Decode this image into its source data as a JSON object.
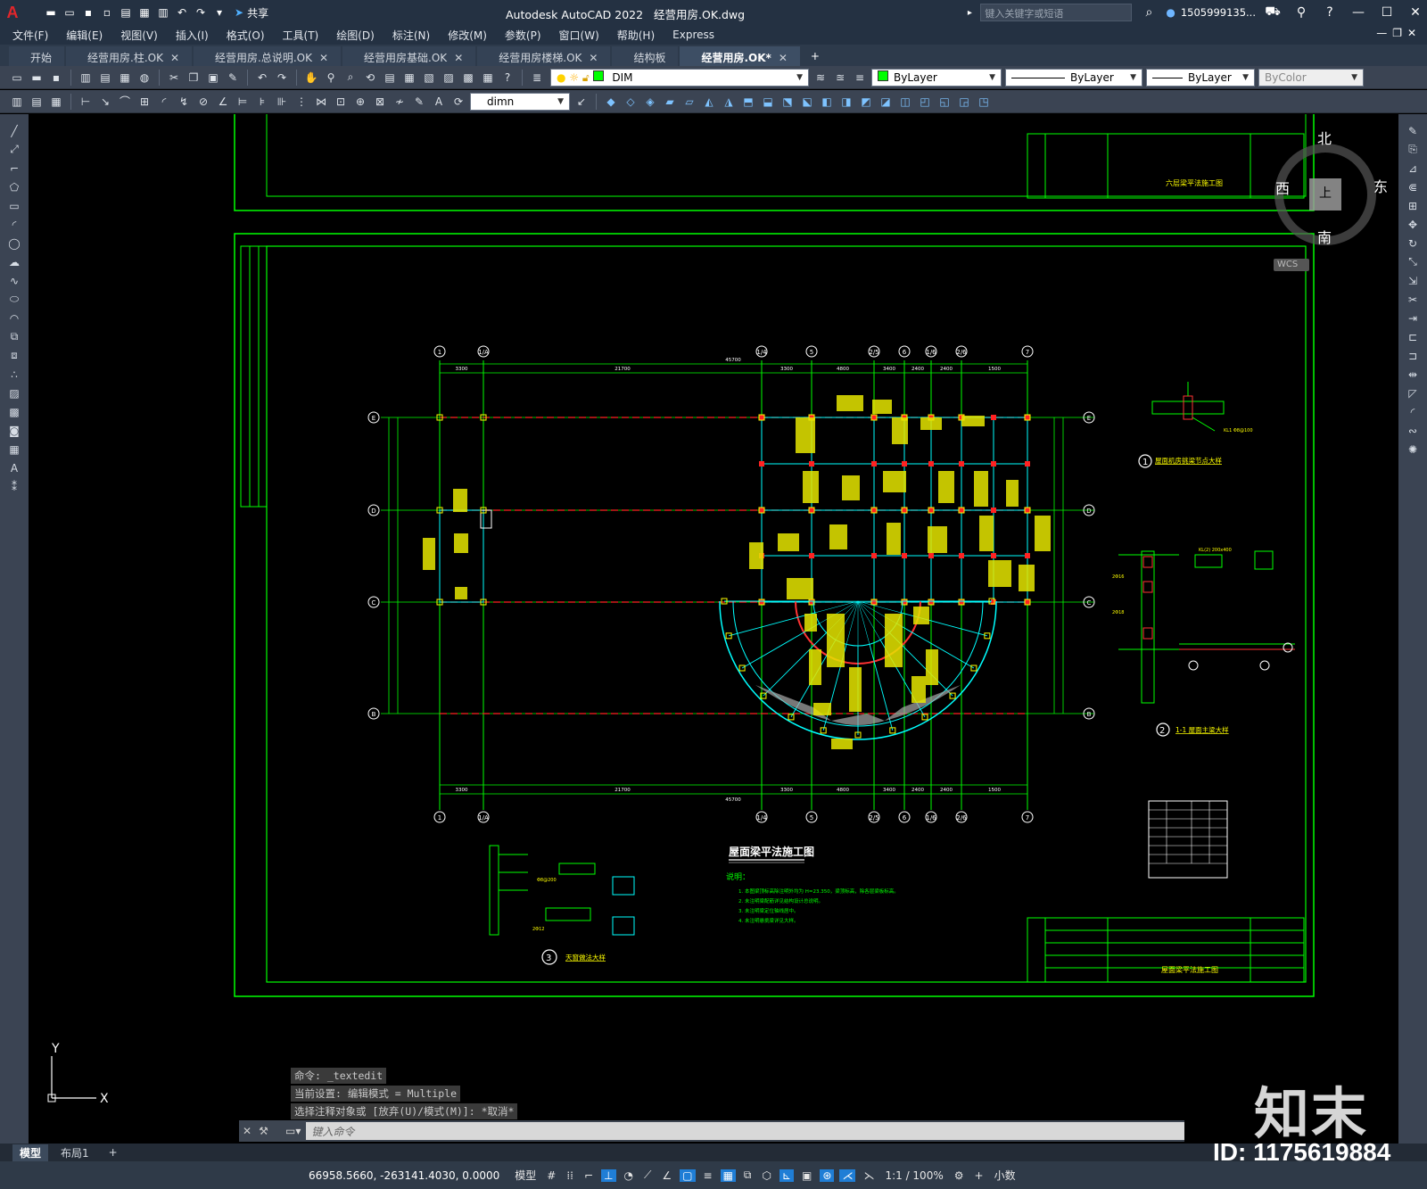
{
  "titlebar": {
    "share_label": "共享",
    "app_title": "Autodesk AutoCAD 2022",
    "file_title": "经营用房.OK.dwg",
    "search_placeholder": "键入关键字或短语",
    "user_name": "1505999135..."
  },
  "menu": [
    "文件(F)",
    "编辑(E)",
    "视图(V)",
    "插入(I)",
    "格式(O)",
    "工具(T)",
    "绘图(D)",
    "标注(N)",
    "修改(M)",
    "参数(P)",
    "窗口(W)",
    "帮助(H)",
    "Express"
  ],
  "tabs": [
    {
      "label": "开始",
      "active": false,
      "closable": false
    },
    {
      "label": "经营用房.柱.OK",
      "active": false,
      "closable": true
    },
    {
      "label": "经营用房.总说明.OK",
      "active": false,
      "closable": true
    },
    {
      "label": "经营用房基础.OK",
      "active": false,
      "closable": true
    },
    {
      "label": "经营用房楼梯.OK",
      "active": false,
      "closable": true
    },
    {
      "label": "结构板",
      "active": false,
      "closable": false
    },
    {
      "label": "经营用房.OK*",
      "active": true,
      "closable": true
    }
  ],
  "toolbar": {
    "layer_value": "DIM",
    "color_value": "ByLayer",
    "linetype_value": "ByLayer",
    "lineweight_value": "ByLayer",
    "plotstyle_value": "ByColor",
    "dimstyle_value": "dimn"
  },
  "compass": {
    "north": "北",
    "south": "南",
    "east": "东",
    "west": "西",
    "center": "上",
    "wcs": "WCS"
  },
  "drawing": {
    "grid_top": [
      "1",
      "1/A",
      "1/4",
      "5",
      "2/5",
      "6",
      "1/6",
      "2/6",
      "7"
    ],
    "grid_rows": [
      "E",
      "D",
      "C",
      "B"
    ],
    "dims_top": [
      "3300",
      "21700",
      "3300",
      "4800",
      "3400",
      "2400",
      "2400",
      "1500",
      "3400"
    ],
    "total_dim": "45700",
    "main_title": "屋面梁平法施工图",
    "notes_title": "说明：",
    "notes": [
      "1. 本图梁顶标高除注明外均为 H=23.350，梁顶标高，除各层梁板标高。",
      "2. 未注明梁配筋详见结构设计总说明。",
      "3. 未注明梁定位轴线居中。",
      "4. 未注明悬挑梁详见大样。"
    ],
    "detail1_label": "屋面机房挑梁节点大样",
    "detail2_label": "1-1 屋面主梁大样",
    "detail3_label": "天窗做法大样",
    "tb_title_top": "六层梁平法施工图",
    "tb_title_bottom": "屋面梁平法施工图"
  },
  "command": {
    "history": [
      "命令: _textedit",
      "当前设置: 编辑模式 = Multiple",
      "选择注释对象或 [放弃(U)/模式(M)]: *取消*"
    ],
    "placeholder": "键入命令"
  },
  "layout_tabs": [
    "模型",
    "布局1"
  ],
  "status": {
    "coords": "66958.5660, -263141.4030, 0.0000",
    "model_label": "模型",
    "scale_label": "1:1 / 100%",
    "units_label": "小数"
  },
  "watermark": {
    "logo": "知末",
    "id": "ID: 1175619884"
  },
  "colors": {
    "titlebar": "#243142",
    "toolbar": "#3b4453",
    "canvas": "#000000",
    "green": "#00ff00",
    "red": "#ff0000",
    "yellow": "#ffff00",
    "cyan": "#00ffff"
  }
}
